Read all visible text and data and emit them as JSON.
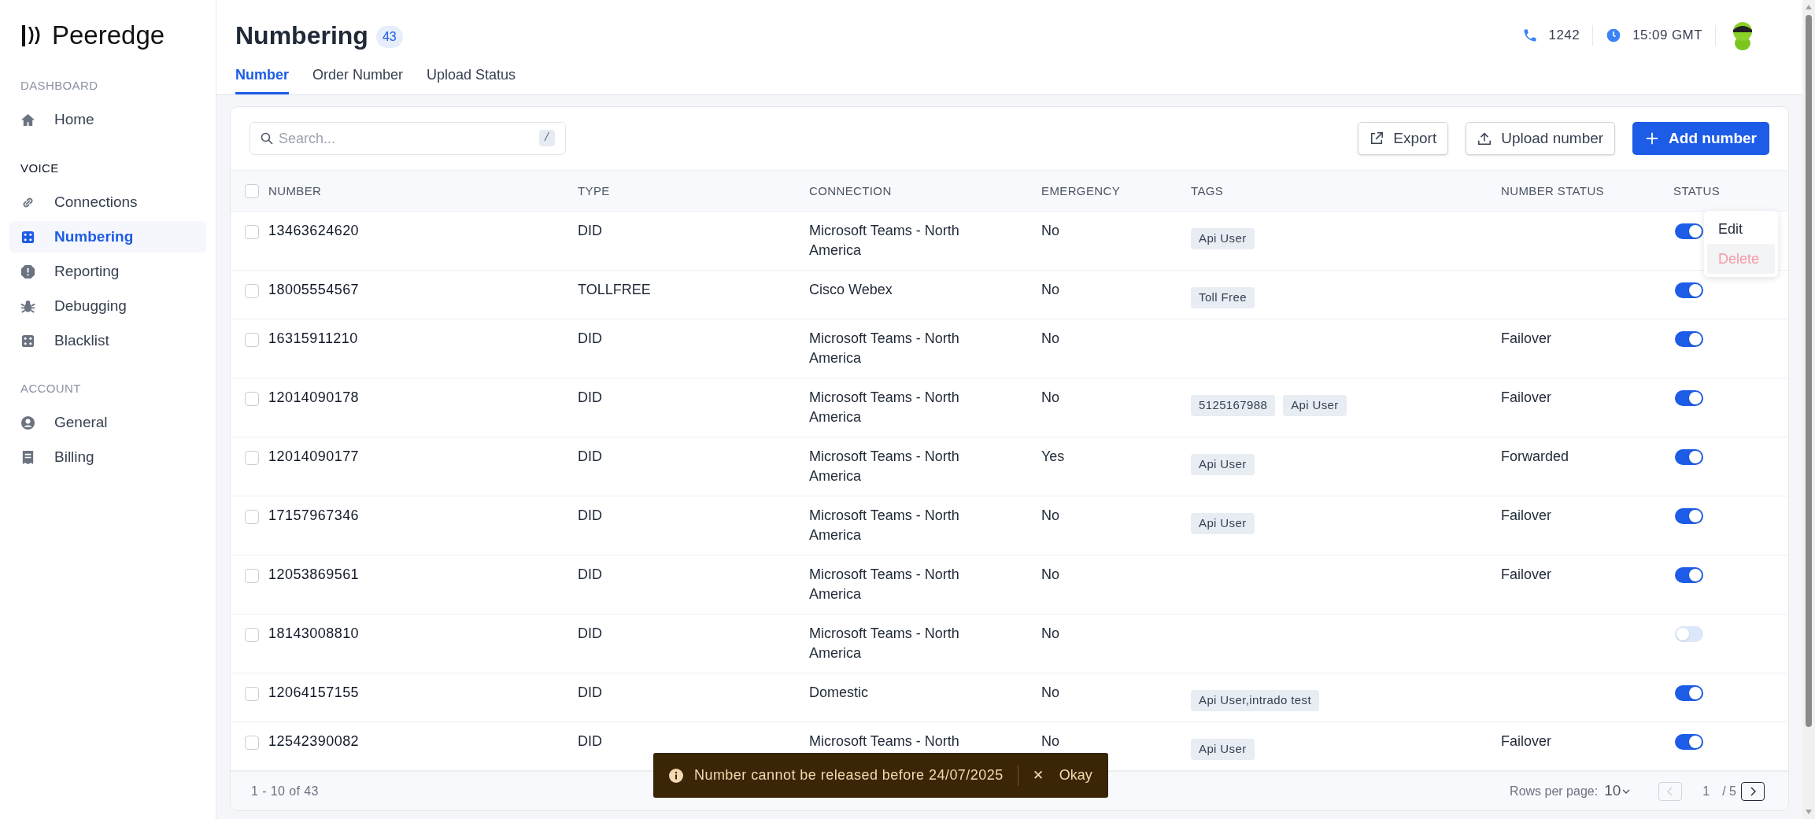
{
  "sidebar": {
    "logo": "Peeredge",
    "sections": [
      {
        "title": "DASHBOARD",
        "active": false,
        "items": [
          {
            "label": "Home",
            "selected": false
          }
        ]
      },
      {
        "title": "VOICE",
        "active": true,
        "items": [
          {
            "label": "Connections",
            "selected": false
          },
          {
            "label": "Numbering",
            "selected": true
          },
          {
            "label": "Reporting",
            "selected": false
          },
          {
            "label": "Debugging",
            "selected": false
          },
          {
            "label": "Blacklist",
            "selected": false
          }
        ]
      },
      {
        "title": "ACCOUNT",
        "active": false,
        "items": [
          {
            "label": "General",
            "selected": false
          },
          {
            "label": "Billing",
            "selected": false
          }
        ]
      }
    ]
  },
  "header": {
    "title": "Numbering",
    "count": "43",
    "phone": "1242",
    "time": "15:09 GMT"
  },
  "tabs": [
    {
      "label": "Number",
      "selected": true
    },
    {
      "label": "Order Number",
      "selected": false
    },
    {
      "label": "Upload Status",
      "selected": false
    }
  ],
  "toolbar": {
    "search": {
      "placeholder": "Search...",
      "shortcut": "/"
    },
    "buttons": [
      {
        "label": "Export",
        "kind": "export"
      },
      {
        "label": "Upload number",
        "kind": "upload"
      },
      {
        "label": "Add number",
        "kind": "add"
      }
    ]
  },
  "table": {
    "select_all_checked": false,
    "columns": [
      "NUMBER",
      "TYPE",
      "CONNECTION",
      "EMERGENCY",
      "TAGS",
      "NUMBER STATUS",
      "STATUS"
    ],
    "rows": [
      {
        "checked": false,
        "number": "13463624620",
        "type": "DID",
        "connection": "Microsoft Teams - North America",
        "emergency": "No",
        "tags": [
          "Api User"
        ],
        "number_status": "",
        "enabled": true
      },
      {
        "checked": false,
        "number": "18005554567",
        "type": "TOLLFREE",
        "connection": "Cisco Webex",
        "emergency": "No",
        "tags": [
          "Toll Free"
        ],
        "number_status": "",
        "enabled": true
      },
      {
        "checked": false,
        "number": "16315911210",
        "type": "DID",
        "connection": "Microsoft Teams - North America",
        "emergency": "No",
        "tags": [],
        "number_status": "Failover",
        "enabled": true
      },
      {
        "checked": false,
        "number": "12014090178",
        "type": "DID",
        "connection": "Microsoft Teams - North America",
        "emergency": "No",
        "tags": [
          "5125167988",
          "Api User"
        ],
        "number_status": "Failover",
        "enabled": true
      },
      {
        "checked": false,
        "number": "12014090177",
        "type": "DID",
        "connection": "Microsoft Teams - North America",
        "emergency": "Yes",
        "tags": [
          "Api User"
        ],
        "number_status": "Forwarded",
        "enabled": true
      },
      {
        "checked": false,
        "number": "17157967346",
        "type": "DID",
        "connection": "Microsoft Teams - North America",
        "emergency": "No",
        "tags": [
          "Api User"
        ],
        "number_status": "Failover",
        "enabled": true
      },
      {
        "checked": false,
        "number": "12053869561",
        "type": "DID",
        "connection": "Microsoft Teams - North America",
        "emergency": "No",
        "tags": [],
        "number_status": "Failover",
        "enabled": true
      },
      {
        "checked": false,
        "number": "18143008810",
        "type": "DID",
        "connection": "Microsoft Teams - North America",
        "emergency": "No",
        "tags": [],
        "number_status": "",
        "enabled": false
      },
      {
        "checked": false,
        "number": "12064157155",
        "type": "DID",
        "connection": "Domestic",
        "emergency": "No",
        "tags": [
          "Api User,intrado test"
        ],
        "number_status": "",
        "enabled": true
      },
      {
        "checked": false,
        "number": "12542390082",
        "type": "DID",
        "connection": "Microsoft Teams - North",
        "emergency": "No",
        "tags": [
          "Api User"
        ],
        "number_status": "Failover",
        "enabled": true
      }
    ]
  },
  "row_menu": {
    "items": [
      {
        "label": "Edit",
        "kind": "normal"
      },
      {
        "label": "Delete",
        "kind": "danger"
      }
    ]
  },
  "footer": {
    "range": "1 - 10 of 43",
    "rows_label": "Rows per page:",
    "rows_value": "10",
    "page": "1",
    "pages": "/ 5"
  },
  "toast": {
    "message": "Number cannot be released before 24/07/2025",
    "action": "Okay",
    "close": "✕"
  }
}
